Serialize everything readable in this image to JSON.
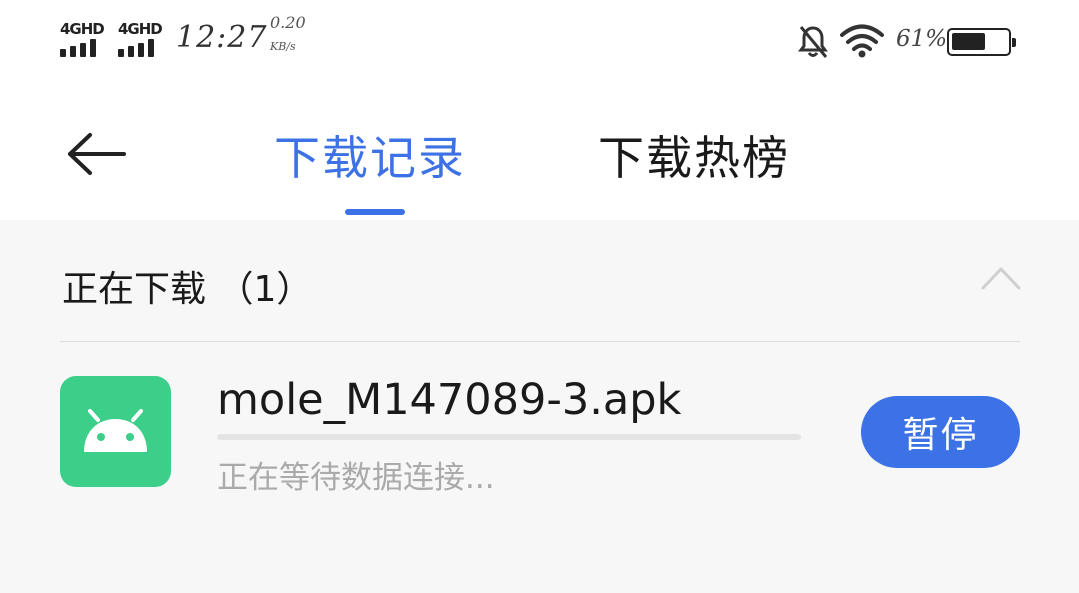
{
  "status_bar": {
    "sim1": "4GHD",
    "sim2": "4GHD",
    "time": "12:27",
    "speed_value": "0.20",
    "speed_unit": "KB/s",
    "battery_percent": "61%",
    "battery_level": 0.61,
    "icons": [
      "signal-icon",
      "bell-off-icon",
      "wifi-icon",
      "battery-icon"
    ]
  },
  "header": {
    "tabs": [
      {
        "label": "下载记录",
        "active": true
      },
      {
        "label": "下载热榜",
        "active": false
      }
    ],
    "back_icon": "arrow-left-icon"
  },
  "section": {
    "title": "正在下载 （1）",
    "collapse_icon": "chevron-up-icon"
  },
  "downloads": [
    {
      "file_name": "mole_M147089-3.apk",
      "status": "正在等待数据连接...",
      "progress": 0,
      "icon": "android-icon",
      "action_label": "暂停"
    }
  ],
  "colors": {
    "accent": "#3d72e6",
    "app_icon_bg": "#3ccf8a",
    "muted_text": "#aaaaaa",
    "background": "#f7f7f7"
  }
}
